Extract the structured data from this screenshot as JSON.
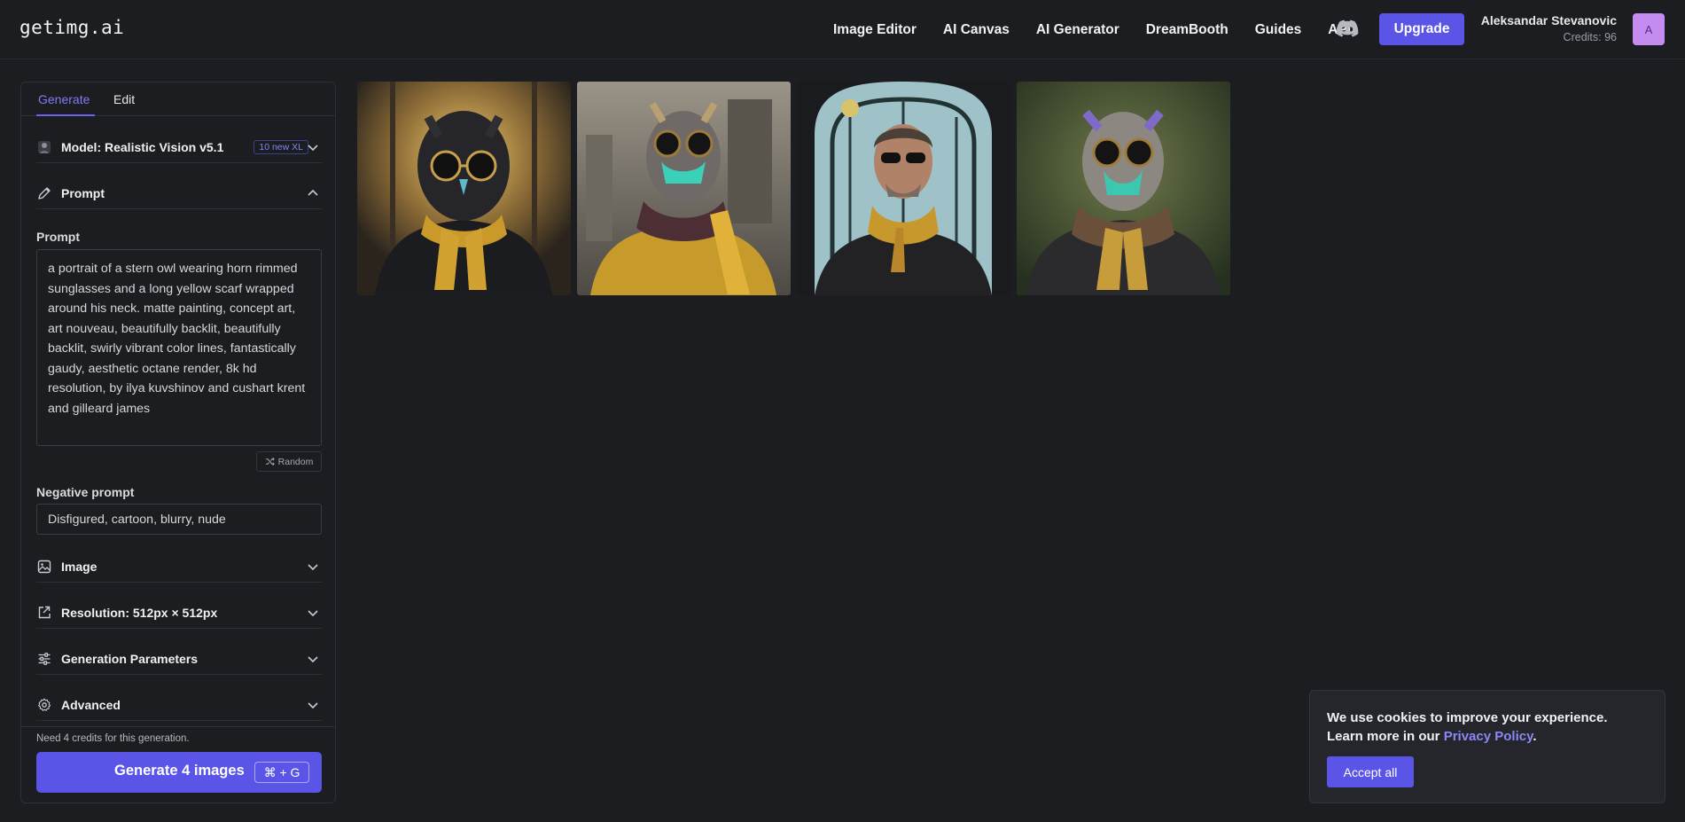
{
  "header": {
    "logo": "getimg.ai",
    "nav": [
      "Image Editor",
      "AI Canvas",
      "AI Generator",
      "DreamBooth",
      "Guides",
      "API"
    ],
    "upgrade_label": "Upgrade",
    "user_name": "Aleksandar Stevanovic",
    "credits": "Credits: 96",
    "avatar_letter": "A"
  },
  "tabs": {
    "generate": "Generate",
    "edit": "Edit"
  },
  "model": {
    "label": "Model: Realistic Vision v5.1",
    "badge": "10 new XL"
  },
  "prompt_section": {
    "title": "Prompt",
    "field_label": "Prompt"
  },
  "prompt_text": "a portrait of a stern owl wearing horn rimmed sunglasses and a long yellow scarf wrapped around his neck. matte painting, concept art, art nouveau, beautifully backlit, beautifully backlit, swirly vibrant color lines, fantastically gaudy, aesthetic octane render, 8k hd resolution, by ilya kuvshinov and cushart krent and gilleard james",
  "random_label": "Random",
  "negative": {
    "label": "Negative prompt",
    "value": "Disfigured, cartoon, blurry, nude"
  },
  "sections": {
    "image": "Image",
    "resolution": "Resolution: 512px × 512px",
    "params": "Generation Parameters",
    "advanced": "Advanced"
  },
  "footer": {
    "need": "Need 4 credits for this generation.",
    "generate_label": "Generate 4 images",
    "shortcut": "⌘ + G"
  },
  "cookie": {
    "text": "We use cookies to improve your experience. Learn more in our ",
    "link": "Privacy Policy",
    "end": ".",
    "accept": "Accept all"
  },
  "colors": {
    "accent": "#5a55e7",
    "background": "#1c1d21",
    "scarf": "#c99a2a"
  }
}
